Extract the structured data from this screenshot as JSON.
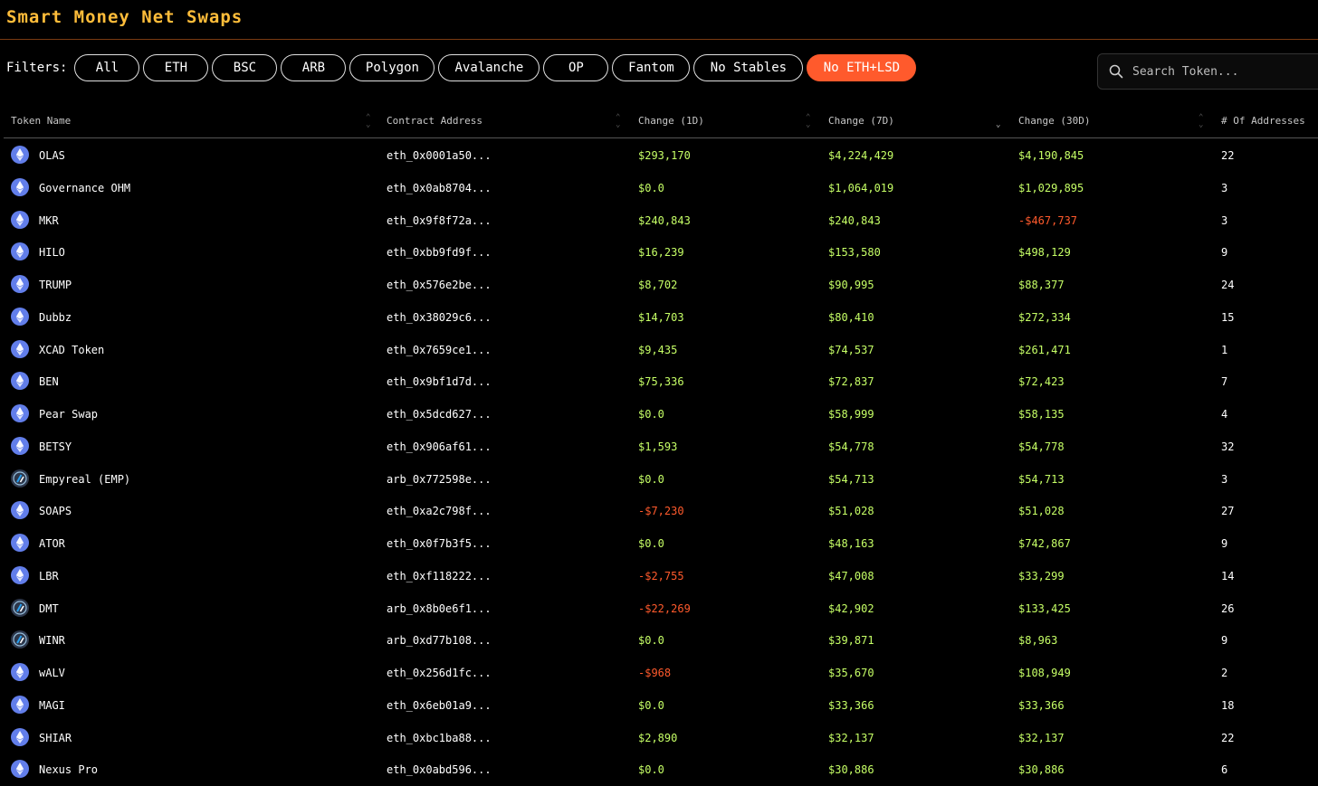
{
  "header": {
    "title": "Smart Money Net Swaps"
  },
  "filters": {
    "label": "Filters:",
    "chips": [
      {
        "label": "All",
        "active": false
      },
      {
        "label": "ETH",
        "active": false
      },
      {
        "label": "BSC",
        "active": false
      },
      {
        "label": "ARB",
        "active": false
      },
      {
        "label": "Polygon",
        "active": false
      },
      {
        "label": "Avalanche",
        "active": false
      },
      {
        "label": "OP",
        "active": false
      },
      {
        "label": "Fantom",
        "active": false
      },
      {
        "label": "No Stables",
        "active": false
      },
      {
        "label": "No ETH+LSD",
        "active": true
      }
    ]
  },
  "search": {
    "placeholder": "Search Token..."
  },
  "colors": {
    "title": "#ffbd3a",
    "active": "#ff5a2c",
    "positive": "#c6ff66",
    "negative": "#ff5a2c",
    "eth_icon": "#627eea",
    "arb_icon": "#2d374b"
  },
  "table": {
    "columns": [
      "Token Name",
      "Contract Address",
      "Change (1D)",
      "Change (7D)",
      "Change (30D)",
      "# Of Addresses"
    ],
    "rows": [
      {
        "icon": "eth",
        "name": "OLAS",
        "contract": "eth_0x0001a50...",
        "c1": "$293,170",
        "c7": "$4,224,429",
        "c30": "$4,190,845",
        "addr": "22"
      },
      {
        "icon": "eth",
        "name": "Governance OHM",
        "contract": "eth_0x0ab8704...",
        "c1": "$0.0",
        "c7": "$1,064,019",
        "c30": "$1,029,895",
        "addr": "3"
      },
      {
        "icon": "eth",
        "name": "MKR",
        "contract": "eth_0x9f8f72a...",
        "c1": "$240,843",
        "c7": "$240,843",
        "c30": "-$467,737",
        "addr": "3"
      },
      {
        "icon": "eth",
        "name": "HILO",
        "contract": "eth_0xbb9fd9f...",
        "c1": "$16,239",
        "c7": "$153,580",
        "c30": "$498,129",
        "addr": "9"
      },
      {
        "icon": "eth",
        "name": "TRUMP",
        "contract": "eth_0x576e2be...",
        "c1": "$8,702",
        "c7": "$90,995",
        "c30": "$88,377",
        "addr": "24"
      },
      {
        "icon": "eth",
        "name": "Dubbz",
        "contract": "eth_0x38029c6...",
        "c1": "$14,703",
        "c7": "$80,410",
        "c30": "$272,334",
        "addr": "15"
      },
      {
        "icon": "eth",
        "name": "XCAD Token",
        "contract": "eth_0x7659ce1...",
        "c1": "$9,435",
        "c7": "$74,537",
        "c30": "$261,471",
        "addr": "1"
      },
      {
        "icon": "eth",
        "name": "BEN",
        "contract": "eth_0x9bf1d7d...",
        "c1": "$75,336",
        "c7": "$72,837",
        "c30": "$72,423",
        "addr": "7"
      },
      {
        "icon": "eth",
        "name": "Pear Swap",
        "contract": "eth_0x5dcd627...",
        "c1": "$0.0",
        "c7": "$58,999",
        "c30": "$58,135",
        "addr": "4"
      },
      {
        "icon": "eth",
        "name": "BETSY",
        "contract": "eth_0x906af61...",
        "c1": "$1,593",
        "c7": "$54,778",
        "c30": "$54,778",
        "addr": "32"
      },
      {
        "icon": "arb",
        "name": "Empyreal (EMP)",
        "contract": "arb_0x772598e...",
        "c1": "$0.0",
        "c7": "$54,713",
        "c30": "$54,713",
        "addr": "3"
      },
      {
        "icon": "eth",
        "name": "SOAPS",
        "contract": "eth_0xa2c798f...",
        "c1": "-$7,230",
        "c7": "$51,028",
        "c30": "$51,028",
        "addr": "27"
      },
      {
        "icon": "eth",
        "name": "ATOR",
        "contract": "eth_0x0f7b3f5...",
        "c1": "$0.0",
        "c7": "$48,163",
        "c30": "$742,867",
        "addr": "9"
      },
      {
        "icon": "eth",
        "name": "LBR",
        "contract": "eth_0xf118222...",
        "c1": "-$2,755",
        "c7": "$47,008",
        "c30": "$33,299",
        "addr": "14"
      },
      {
        "icon": "arb",
        "name": "DMT",
        "contract": "arb_0x8b0e6f1...",
        "c1": "-$22,269",
        "c7": "$42,902",
        "c30": "$133,425",
        "addr": "26"
      },
      {
        "icon": "arb",
        "name": "WINR",
        "contract": "arb_0xd77b108...",
        "c1": "$0.0",
        "c7": "$39,871",
        "c30": "$8,963",
        "addr": "9"
      },
      {
        "icon": "eth",
        "name": "wALV",
        "contract": "eth_0x256d1fc...",
        "c1": "-$968",
        "c7": "$35,670",
        "c30": "$108,949",
        "addr": "2"
      },
      {
        "icon": "eth",
        "name": "MAGI",
        "contract": "eth_0x6eb01a9...",
        "c1": "$0.0",
        "c7": "$33,366",
        "c30": "$33,366",
        "addr": "18"
      },
      {
        "icon": "eth",
        "name": "SHIAR",
        "contract": "eth_0xbc1ba88...",
        "c1": "$2,890",
        "c7": "$32,137",
        "c30": "$32,137",
        "addr": "22"
      },
      {
        "icon": "eth",
        "name": "Nexus Pro",
        "contract": "eth_0x0abd596...",
        "c1": "$0.0",
        "c7": "$30,886",
        "c30": "$30,886",
        "addr": "6"
      }
    ]
  }
}
